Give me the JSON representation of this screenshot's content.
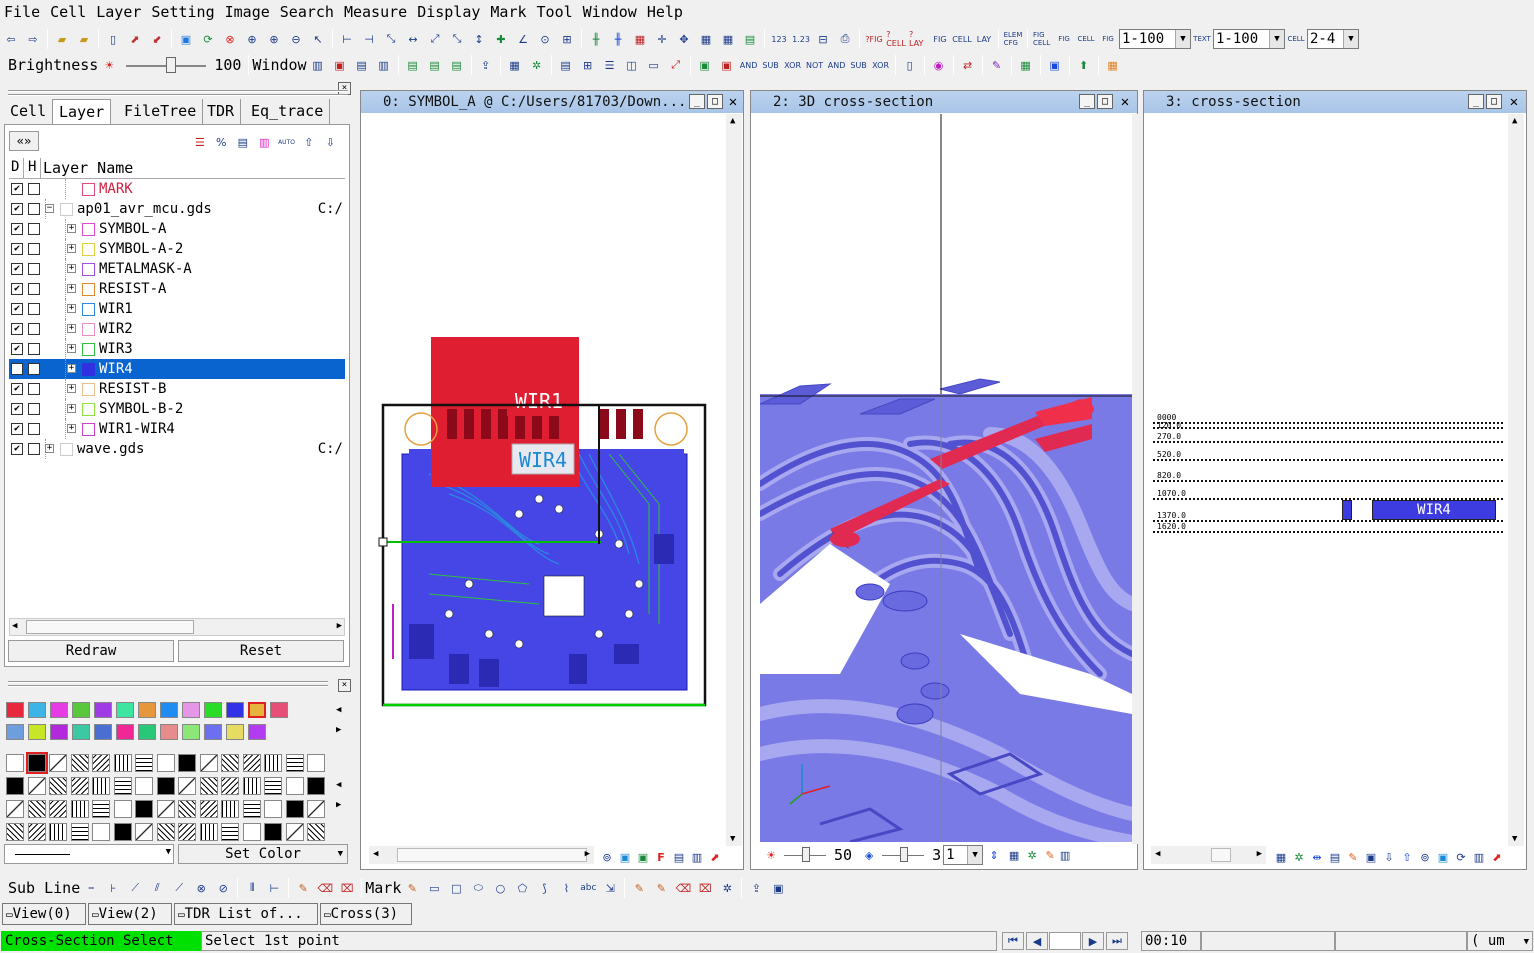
{
  "menu": [
    "File",
    "Cell",
    "Layer",
    "Setting",
    "Image",
    "Search",
    "Measure",
    "Display",
    "Mark",
    "Tool",
    "Window",
    "Help"
  ],
  "toolbar": {
    "range1": "1-100",
    "range2": "1-100",
    "range3": "2-4",
    "brightness_label": "Brightness",
    "brightness_value": "100",
    "window_label": "Window",
    "bool_ops": [
      "AND",
      "SUB",
      "XOR",
      "NOT",
      "AND",
      "SUB",
      "XOR"
    ]
  },
  "left_panel": {
    "tabs": [
      "Cell",
      "Layer",
      "FileTree",
      "TDR",
      "Eq_trace"
    ],
    "headers": {
      "d": "D",
      "h": "H",
      "name": "Layer Name"
    },
    "layers": [
      {
        "name": "MARK",
        "color": "#e34a7a",
        "checked": true,
        "path": "",
        "level": 1,
        "tree": "none"
      },
      {
        "name": "ap01_avr_mcu.gds",
        "color": "#cccccc",
        "checked": true,
        "path": "C:/",
        "level": 0,
        "tree": "minus"
      },
      {
        "name": "SYMBOL-A",
        "color": "#e04ad0",
        "checked": true,
        "path": "",
        "level": 1,
        "tree": "plus"
      },
      {
        "name": "SYMBOL-A-2",
        "color": "#e0d040",
        "checked": true,
        "path": "",
        "level": 1,
        "tree": "plus"
      },
      {
        "name": "METALMASK-A",
        "color": "#a050e0",
        "checked": true,
        "path": "",
        "level": 1,
        "tree": "plus"
      },
      {
        "name": "RESIST-A",
        "color": "#e08a30",
        "checked": true,
        "path": "",
        "level": 1,
        "tree": "plus"
      },
      {
        "name": "WIR1",
        "color": "#2a8ae0",
        "checked": true,
        "path": "",
        "level": 1,
        "tree": "plus"
      },
      {
        "name": "WIR2",
        "color": "#e890c8",
        "checked": true,
        "path": "",
        "level": 1,
        "tree": "plus"
      },
      {
        "name": "WIR3",
        "color": "#30c040",
        "checked": true,
        "path": "",
        "level": 1,
        "tree": "plus"
      },
      {
        "name": "WIR4",
        "color": "#3030e0",
        "checked": true,
        "path": "",
        "level": 1,
        "tree": "plus",
        "selected": true
      },
      {
        "name": "RESIST-B",
        "color": "#e8c090",
        "checked": true,
        "path": "",
        "level": 1,
        "tree": "plus"
      },
      {
        "name": "SYMBOL-B-2",
        "color": "#90e040",
        "checked": true,
        "path": "",
        "level": 1,
        "tree": "plus"
      },
      {
        "name": "WIR1-WIR4",
        "color": "#d040d0",
        "checked": true,
        "path": "",
        "level": 1,
        "tree": "plus"
      },
      {
        "name": "wave.gds",
        "color": "#cccccc",
        "checked": true,
        "path": "C:/",
        "level": 0,
        "tree": "plus"
      }
    ],
    "redraw_label": "Redraw",
    "reset_label": "Reset"
  },
  "palette": {
    "row1": [
      "#e8283c",
      "#3cb4e6",
      "#e63ce6",
      "#5ac83c",
      "#a03ce6",
      "#3ce6a0",
      "#e6963c",
      "#1e8cf0",
      "#e696e6",
      "#28dc28",
      "#3232e6",
      "#e6b43c",
      "#e65078"
    ],
    "row2": [
      "#6e9ede",
      "#c8e628",
      "#b428dc",
      "#3cc8a0",
      "#4a6ed2",
      "#f02896",
      "#28c878",
      "#e68c8c",
      "#8ce678",
      "#6e6ef0",
      "#e6dc64",
      "#b43cf0"
    ],
    "line_label": "",
    "set_color_label": "Set Color"
  },
  "views": [
    {
      "title": "0: SYMBOL_A @ C:/Users/81703/Down...",
      "labels": [
        "WIR1",
        "WIR4"
      ]
    },
    {
      "title": "2: 3D cross-section",
      "zoom_value": "50",
      "depth_value": "3",
      "depth_select": "1"
    },
    {
      "title": "3: cross-section",
      "region_label": "WIR4",
      "level_labels": [
        "0000",
        "120.0",
        "270.0",
        "520.0",
        "820.0",
        "1070.0",
        "1370.0",
        "1620.0"
      ]
    }
  ],
  "bottom_toolbar": {
    "subline_label": "Sub Line",
    "mark_label": "Mark",
    "abc": "abc"
  },
  "window_tabs": [
    "View(0)",
    "View(2)",
    "TDR List of...",
    "Cross(3)"
  ],
  "status": {
    "mode": "Cross-Section Select",
    "prompt": "Select 1st point",
    "time": "00:10",
    "unit": "( um"
  },
  "colors": {
    "accent_green": "#00e000",
    "selection": "#0a64d0",
    "title_bar": "#b4cdec",
    "metal_blue": "#4040e0",
    "red_layer": "#e01e32"
  }
}
